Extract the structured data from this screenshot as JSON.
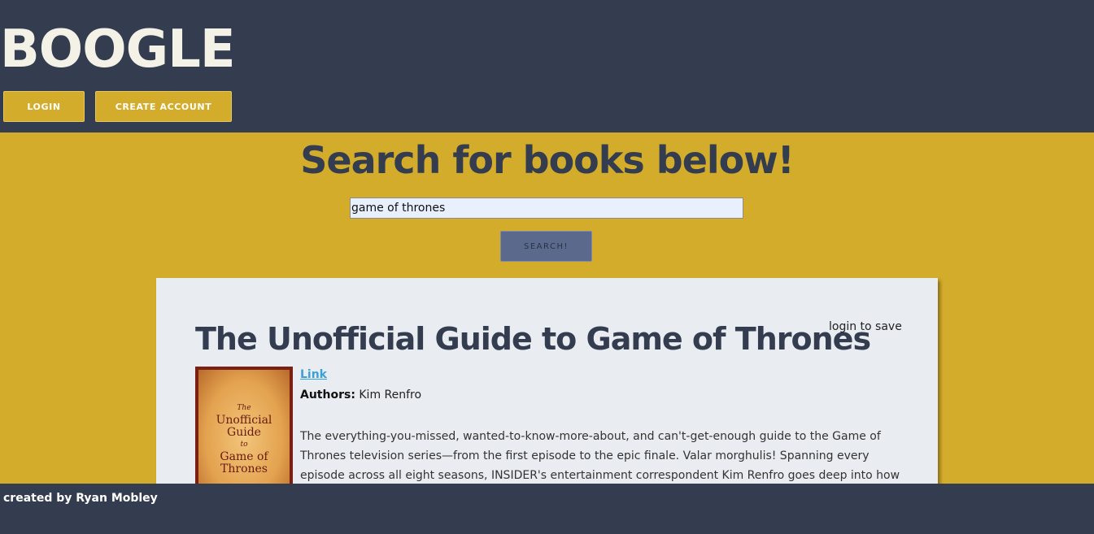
{
  "header": {
    "logo": "BOOGLE",
    "login_label": "LOGIN",
    "create_account_label": "CREATE ACCOUNT"
  },
  "search": {
    "title": "Search for books below!",
    "input_value": "game of thrones",
    "button_label": "SEARCH!"
  },
  "results": [
    {
      "title": "The Unofficial Guide to Game of Thrones",
      "save_text": "login to save",
      "link_label": "Link",
      "authors_label": "Authors:",
      "authors": "Kim Renfro",
      "cover_text": [
        "The",
        "Unofficial",
        "Guide",
        "to",
        "Game of",
        "Thrones"
      ],
      "description": "The everything-you-missed, wanted-to-know-more-about, and can't-get-enough guide to the Game of Thrones television series—from the first episode to the epic finale. Valar morghulis! Spanning every episode across all eight seasons, INSIDER's entertainment correspondent Kim Renfro goes deep into how the show was"
    }
  ],
  "footer": {
    "credit": "created by Ryan Mobley"
  },
  "colors": {
    "navy": "#343d50",
    "gold": "#d4ac2b",
    "card": "#e9ecf0",
    "link": "#3aa0d8"
  }
}
